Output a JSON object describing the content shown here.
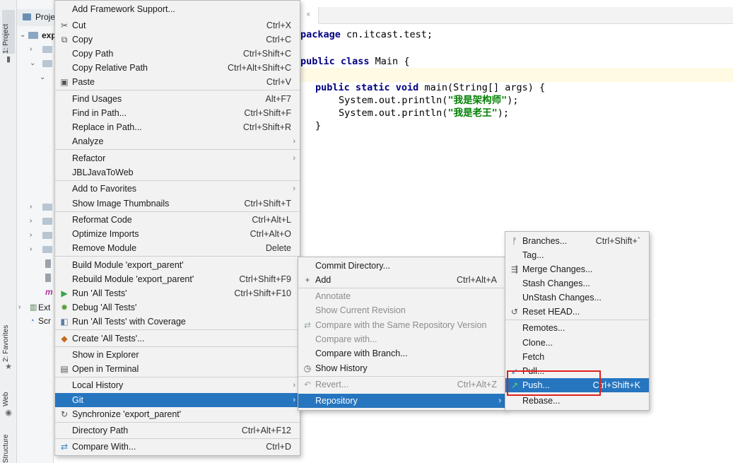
{
  "left_strip": {
    "project_label": "1: Project",
    "favorites_label": "2: Favorites",
    "web_label": "Web",
    "structure_label": "Structure"
  },
  "project_panel": {
    "header": "Proje",
    "root_item": "exp",
    "ext_item": "Ext",
    "scr_item": "Scr"
  },
  "editor": {
    "tab_close": "×",
    "lines": {
      "l1_kw": "package",
      "l1_rest": " cn.itcast.test;",
      "l2_kw": "public class",
      "l2_rest": " Main {",
      "l3_kw": "public static void",
      "l3_rest": " main(String[] args) {",
      "l4_pre": "System.out.println(",
      "l4_str": "\"我是架构师\"",
      "l4_post": ");",
      "l5_pre": "System.out.println(",
      "l5_str": "\"我是老王\"",
      "l5_post": ");",
      "l6": "}"
    }
  },
  "context_menu": {
    "items": [
      {
        "label": "Add Framework Support...",
        "shortcut": ""
      },
      {
        "label": "Cut",
        "shortcut": "Ctrl+X"
      },
      {
        "label": "Copy",
        "shortcut": "Ctrl+C"
      },
      {
        "label": "Copy Path",
        "shortcut": "Ctrl+Shift+C"
      },
      {
        "label": "Copy Relative Path",
        "shortcut": "Ctrl+Alt+Shift+C"
      },
      {
        "label": "Paste",
        "shortcut": "Ctrl+V"
      },
      {
        "label": "Find Usages",
        "shortcut": "Alt+F7"
      },
      {
        "label": "Find in Path...",
        "shortcut": "Ctrl+Shift+F"
      },
      {
        "label": "Replace in Path...",
        "shortcut": "Ctrl+Shift+R"
      },
      {
        "label": "Analyze",
        "shortcut": ""
      },
      {
        "label": "Refactor",
        "shortcut": ""
      },
      {
        "label": "JBLJavaToWeb",
        "shortcut": ""
      },
      {
        "label": "Add to Favorites",
        "shortcut": ""
      },
      {
        "label": "Show Image Thumbnails",
        "shortcut": "Ctrl+Shift+T"
      },
      {
        "label": "Reformat Code",
        "shortcut": "Ctrl+Alt+L"
      },
      {
        "label": "Optimize Imports",
        "shortcut": "Ctrl+Alt+O"
      },
      {
        "label": "Remove Module",
        "shortcut": "Delete"
      },
      {
        "label": "Build Module 'export_parent'",
        "shortcut": ""
      },
      {
        "label": "Rebuild Module 'export_parent'",
        "shortcut": "Ctrl+Shift+F9"
      },
      {
        "label": "Run 'All Tests'",
        "shortcut": "Ctrl+Shift+F10"
      },
      {
        "label": "Debug 'All Tests'",
        "shortcut": ""
      },
      {
        "label": "Run 'All Tests' with Coverage",
        "shortcut": ""
      },
      {
        "label": "Create 'All Tests'...",
        "shortcut": ""
      },
      {
        "label": "Show in Explorer",
        "shortcut": ""
      },
      {
        "label": "Open in Terminal",
        "shortcut": ""
      },
      {
        "label": "Local History",
        "shortcut": ""
      },
      {
        "label": "Git",
        "shortcut": ""
      },
      {
        "label": "Synchronize 'export_parent'",
        "shortcut": ""
      },
      {
        "label": "Directory Path",
        "shortcut": "Ctrl+Alt+F12"
      },
      {
        "label": "Compare With...",
        "shortcut": "Ctrl+D"
      }
    ]
  },
  "git_menu": {
    "items": [
      {
        "label": "Commit Directory...",
        "shortcut": ""
      },
      {
        "label": "Add",
        "shortcut": "Ctrl+Alt+A"
      },
      {
        "label": "Annotate",
        "shortcut": ""
      },
      {
        "label": "Show Current Revision",
        "shortcut": ""
      },
      {
        "label": "Compare with the Same Repository Version",
        "shortcut": ""
      },
      {
        "label": "Compare with...",
        "shortcut": ""
      },
      {
        "label": "Compare with Branch...",
        "shortcut": ""
      },
      {
        "label": "Show History",
        "shortcut": ""
      },
      {
        "label": "Revert...",
        "shortcut": "Ctrl+Alt+Z"
      },
      {
        "label": "Repository",
        "shortcut": ""
      }
    ]
  },
  "repository_menu": {
    "items": [
      {
        "label": "Branches...",
        "shortcut": "Ctrl+Shift+`"
      },
      {
        "label": "Tag...",
        "shortcut": ""
      },
      {
        "label": "Merge Changes...",
        "shortcut": ""
      },
      {
        "label": "Stash Changes...",
        "shortcut": ""
      },
      {
        "label": "UnStash Changes...",
        "shortcut": ""
      },
      {
        "label": "Reset HEAD...",
        "shortcut": ""
      },
      {
        "label": "Remotes...",
        "shortcut": ""
      },
      {
        "label": "Clone...",
        "shortcut": ""
      },
      {
        "label": "Fetch",
        "shortcut": ""
      },
      {
        "label": "Pull...",
        "shortcut": ""
      },
      {
        "label": "Push...",
        "shortcut": "Ctrl+Shift+K"
      },
      {
        "label": "Rebase...",
        "shortcut": ""
      }
    ]
  },
  "colors": {
    "selection": "#2675bf",
    "highlight_box": "#e0201c",
    "keyword": "#000080",
    "string": "#008000"
  }
}
